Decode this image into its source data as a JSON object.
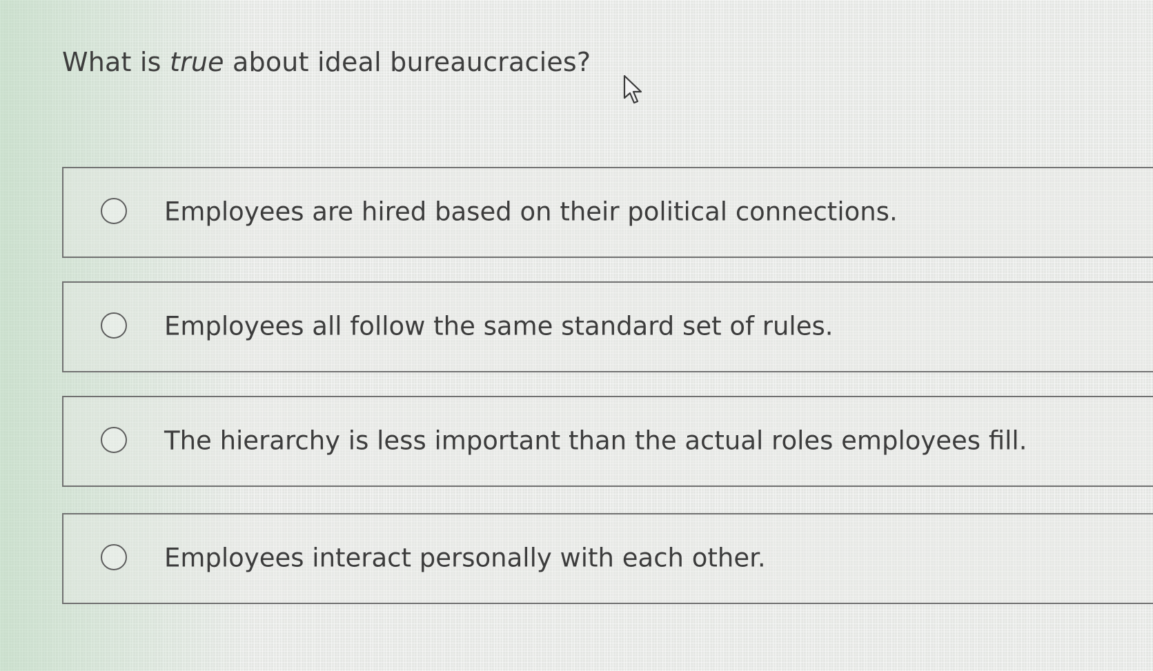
{
  "question": {
    "prefix": "What is ",
    "emphasis": "true",
    "suffix": " about ideal bureaucracies?"
  },
  "options": [
    {
      "label": "Employees are hired based on their political connections.",
      "selected": false
    },
    {
      "label": "Employees all follow the same standard set of rules.",
      "selected": false
    },
    {
      "label": "The hierarchy is less important than the actual roles employees fill.",
      "selected": false
    },
    {
      "label": "Employees interact personally with each other.",
      "selected": false
    }
  ],
  "colors": {
    "background": "#e4e6e3",
    "border": "#707070",
    "text": "#3c3c3c"
  },
  "icons": {
    "radio": "radio-unchecked-icon",
    "cursor": "mouse-pointer-icon"
  }
}
